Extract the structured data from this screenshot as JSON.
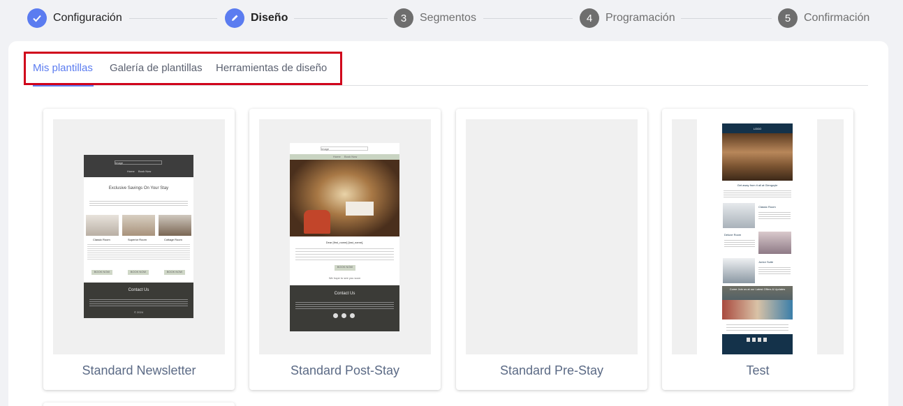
{
  "stepper": {
    "steps": [
      {
        "number": "",
        "label": "Configuración",
        "state": "done"
      },
      {
        "number": "",
        "label": "Diseño",
        "state": "current"
      },
      {
        "number": "3",
        "label": "Segmentos",
        "state": "pending"
      },
      {
        "number": "4",
        "label": "Programación",
        "state": "pending"
      },
      {
        "number": "5",
        "label": "Confirmación",
        "state": "pending"
      }
    ]
  },
  "tabs": [
    {
      "label": "Mis plantillas",
      "active": true
    },
    {
      "label": "Galería de plantillas",
      "active": false
    },
    {
      "label": "Herramientas de diseño",
      "active": false
    }
  ],
  "templates": [
    {
      "name": "Standard Newsletter",
      "preview": {
        "logo": "Image",
        "nav": [
          "Home",
          "Book Now"
        ],
        "heading": "Exclusive Savings On Your Stay",
        "rooms": [
          "Classic Room",
          "Superior Room",
          "Cottage Room"
        ],
        "button": "BOOK NOW",
        "footer_heading": "Contact Us",
        "copyright": "© 2024"
      }
    },
    {
      "name": "Standard Post-Stay",
      "preview": {
        "logo": "Image",
        "nav": [
          "Home",
          "Book Now"
        ],
        "greeting": "Dear [first_name] [last_name],",
        "button": "BOOK NOW",
        "signoff": "We hope to see you soon",
        "footer_heading": "Contact Us"
      }
    },
    {
      "name": "Standard Pre-Stay",
      "preview": {}
    },
    {
      "name": "Test",
      "preview": {
        "logo": "LOGO",
        "heading": "Get away from it all at Glengoyle",
        "rooms": [
          "Classic Room",
          "Deluxe Room",
          "Junior Suite"
        ],
        "banner": "Come Join us at our Latest Offers & Updates"
      }
    }
  ],
  "colors": {
    "accent": "#5b7cf0",
    "pending_step": "#6e6e6e",
    "highlight_box": "#d0021b",
    "card_title": "#5b6a85"
  }
}
